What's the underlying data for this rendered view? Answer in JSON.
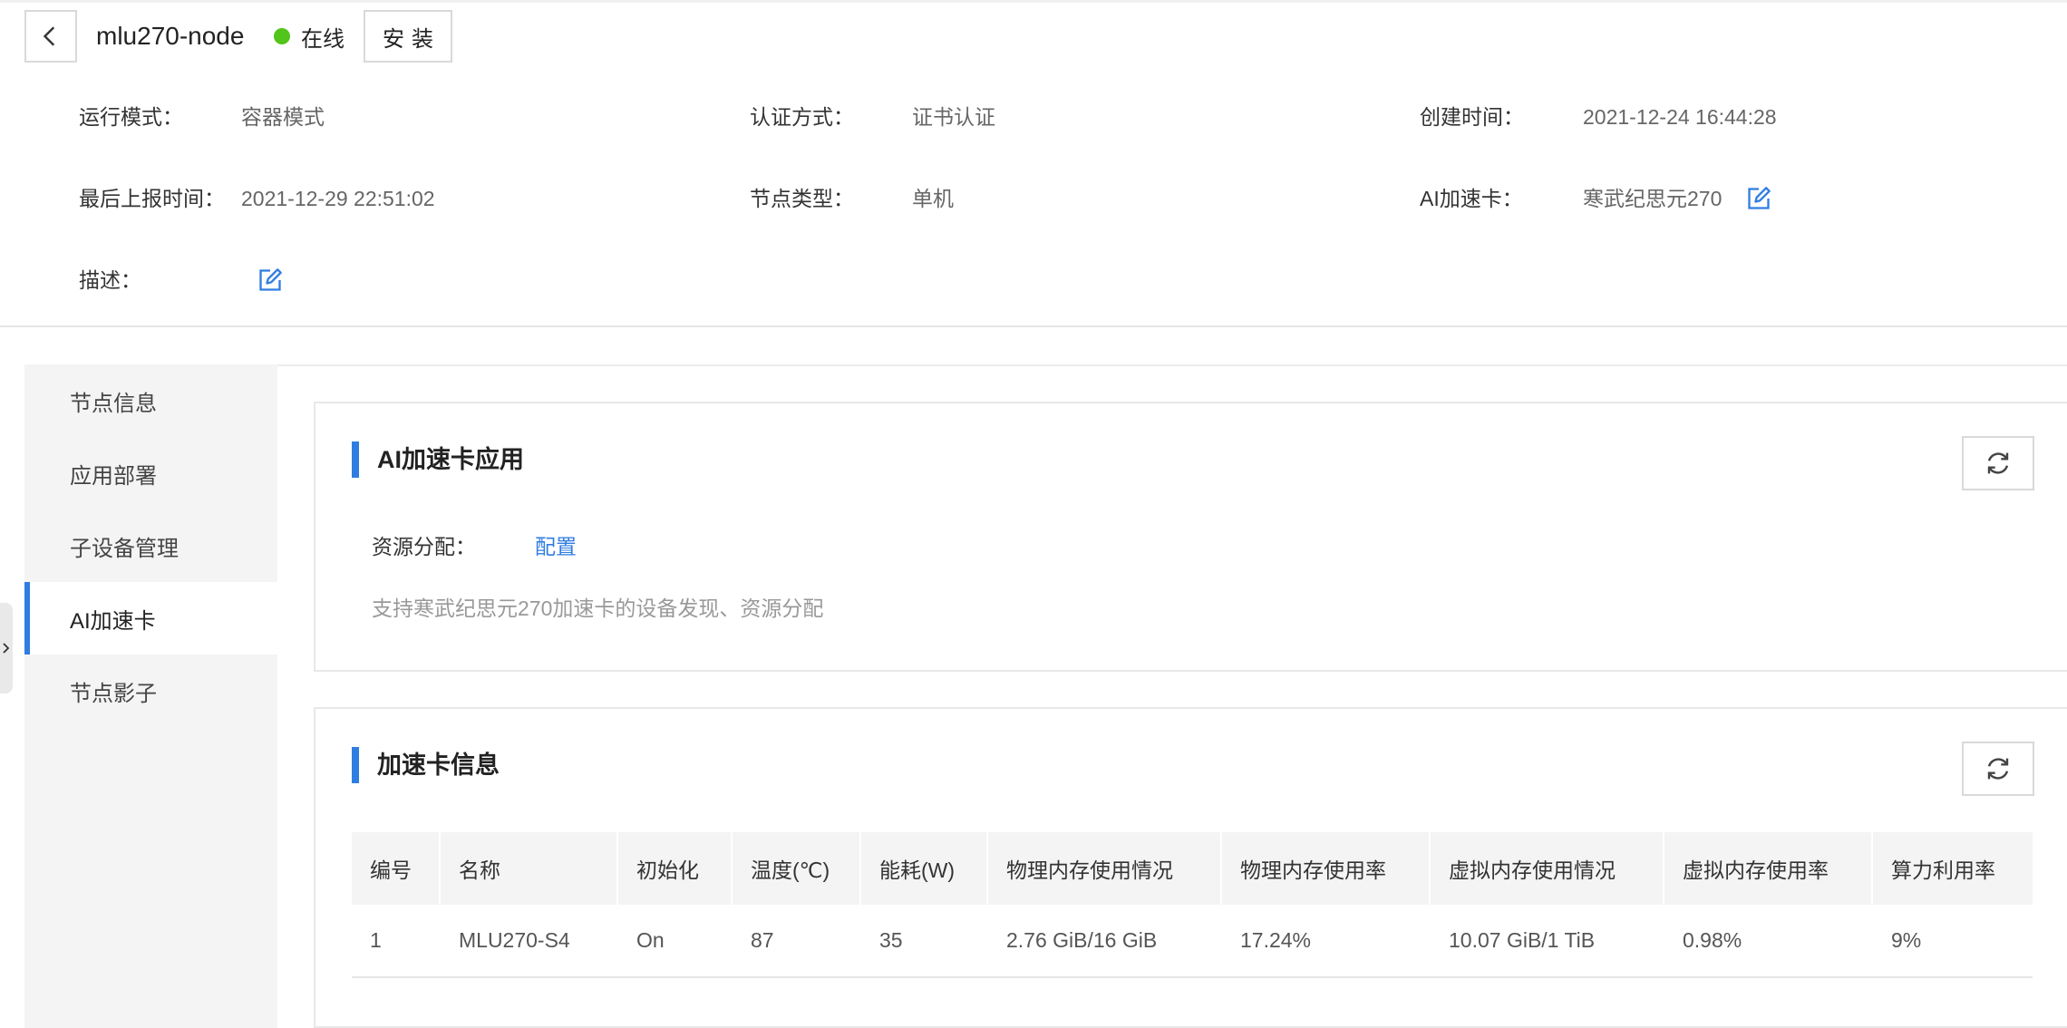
{
  "header": {
    "node_name": "mlu270-node",
    "status_text": "在线",
    "status_color": "#52c41a",
    "install_label": "安装"
  },
  "info": {
    "run_mode_label": "运行模式：",
    "run_mode_value": "容器模式",
    "auth_label": "认证方式：",
    "auth_value": "证书认证",
    "created_label": "创建时间：",
    "created_value": "2021-12-24 16:44:28",
    "last_report_label": "最后上报时间：",
    "last_report_value": "2021-12-29 22:51:02",
    "node_type_label": "节点类型：",
    "node_type_value": "单机",
    "ai_card_label": "AI加速卡：",
    "ai_card_value": "寒武纪思元270",
    "desc_label": "描述："
  },
  "sidebar": {
    "items": [
      {
        "label": "节点信息"
      },
      {
        "label": "应用部署"
      },
      {
        "label": "子设备管理"
      },
      {
        "label": "AI加速卡"
      },
      {
        "label": "节点影子"
      }
    ],
    "active_index": 3
  },
  "app_panel": {
    "title": "AI加速卡应用",
    "resource_label": "资源分配：",
    "resource_link": "配置",
    "description": "支持寒武纪思元270加速卡的设备发现、资源分配"
  },
  "card_panel": {
    "title": "加速卡信息",
    "table": {
      "headers": [
        "编号",
        "名称",
        "初始化",
        "温度(℃)",
        "能耗(W)",
        "物理内存使用情况",
        "物理内存使用率",
        "虚拟内存使用情况",
        "虚拟内存使用率",
        "算力利用率"
      ],
      "rows": [
        [
          "1",
          "MLU270-S4",
          "On",
          "87",
          "35",
          "2.76 GiB/16 GiB",
          "17.24%",
          "10.07 GiB/1 TiB",
          "0.98%",
          "9%"
        ]
      ]
    }
  },
  "colors": {
    "accent": "#2f7de1",
    "sidebar_bg": "#f4f4f4",
    "table_header_bg": "#f4f4f4"
  },
  "icons": {
    "back": "chevron-left-icon",
    "edit": "edit-icon",
    "refresh": "refresh-icon",
    "collapse": "chevron-right-icon"
  }
}
